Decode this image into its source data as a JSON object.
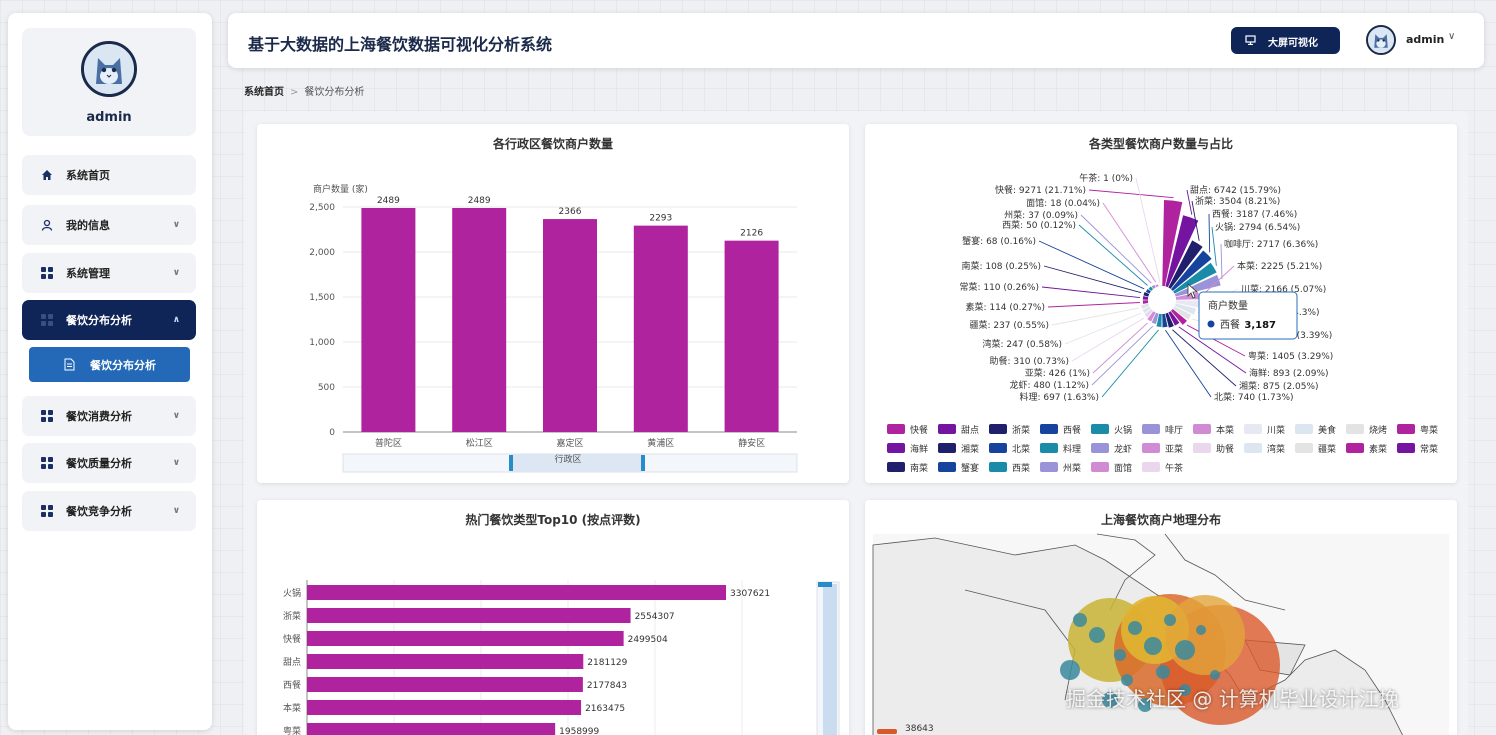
{
  "app": {
    "title": "基于大数据的上海餐饮数据可视化分析系统",
    "bigscreen_label": "大屏可视化",
    "username": "admin"
  },
  "sidebar": {
    "username": "admin",
    "items": [
      {
        "label": "系统首页",
        "icon": "home-icon"
      },
      {
        "label": "我的信息",
        "icon": "user-icon"
      },
      {
        "label": "系统管理",
        "icon": "grid-icon"
      },
      {
        "label": "餐饮分布分析",
        "icon": "grid-icon",
        "active": true
      },
      {
        "label": "餐饮消费分析",
        "icon": "grid-icon"
      },
      {
        "label": "餐饮质量分析",
        "icon": "grid-icon"
      },
      {
        "label": "餐饮竞争分析",
        "icon": "grid-icon"
      }
    ],
    "submenu_label": "餐饮分布分析"
  },
  "breadcrumb": {
    "home": "系统首页",
    "current": "餐饮分布分析"
  },
  "colors": {
    "navy": "#0f2557",
    "magenta": "#b0239f",
    "blue": "#2369b8"
  },
  "chart_data": [
    {
      "type": "bar",
      "title": "各行政区餐饮商户数量",
      "ylabel": "商户数量 (家)",
      "xlabel": "行政区",
      "categories": [
        "普陀区",
        "松江区",
        "嘉定区",
        "黄浦区",
        "静安区"
      ],
      "values": [
        2489,
        2489,
        2366,
        2293,
        2126
      ],
      "ylim": [
        0,
        2500
      ],
      "yticks": [
        "0",
        "500",
        "1,000",
        "1,500",
        "2,000",
        "2,500"
      ]
    },
    {
      "type": "pie",
      "title": "各类型餐饮商户数量与占比",
      "labels": [
        "快餐: 9271 (21.71%)",
        "甜点: 6742 (15.79%)",
        "浙菜: 3504 (8.21%)",
        "西餐: 3187 (7.46%)",
        "火锅: 2794 (6.54%)",
        "咖啡厅: 2717 (6.36%)",
        "本菜: 2225 (5.21%)",
        "川菜: 2166 (5.07%)",
        "美食: 1835 (4.3%)",
        "烧烤: 1446 (3.39%)",
        "粤菜: 1405 (3.29%)",
        "海鲜: 893 (2.09%)",
        "湘菜: 875 (2.05%)",
        "北菜: 740 (1.73%)",
        "料理: 697 (1.63%)",
        "龙虾: 480 (1.12%)",
        "亚菜: 426 (1%)",
        "助餐: 310 (0.73%)",
        "湾菜: 247 (0.58%)",
        "疆菜: 237 (0.55%)",
        "素菜: 114 (0.27%)",
        "常菜: 110 (0.26%)",
        "南菜: 108 (0.25%)",
        "蟹宴: 68 (0.16%)",
        "西菜: 50 (0.12%)",
        "州菜: 37 (0.09%)",
        "面馆: 18 (0.04%)",
        "午茶: 1 (0%)"
      ],
      "values": [
        9271,
        6742,
        3504,
        3187,
        2794,
        2717,
        2225,
        2166,
        1835,
        1446,
        1405,
        893,
        875,
        740,
        697,
        480,
        426,
        310,
        247,
        237,
        114,
        110,
        108,
        68,
        50,
        37,
        18,
        1
      ],
      "legend": [
        "快餐",
        "甜点",
        "浙菜",
        "西餐",
        "火锅",
        "咖啡厅",
        "本菜",
        "川菜",
        "美食",
        "烧烤",
        "粤菜",
        "海鲜",
        "湘菜",
        "北菜",
        "料理",
        "龙虾",
        "亚菜",
        "助餐",
        "湾菜",
        "疆菜",
        "素菜",
        "常菜",
        "南菜",
        "蟹宴",
        "西菜",
        "州菜",
        "面馆",
        "午茶"
      ],
      "legend_display": [
        "快餐",
        "甜点",
        "浙菜",
        "西餐",
        "火锅",
        "啡厅",
        "本菜",
        "川菜",
        "美食",
        "烧烤",
        "粤菜",
        "海鲜",
        "湘菜",
        "北菜",
        "料理",
        "龙虾",
        "亚菜",
        "助餐",
        "湾菜",
        "疆菜",
        "素菜",
        "常菜",
        "南菜",
        "蟹宴",
        "西菜",
        "州菜",
        "面馆",
        "午茶"
      ],
      "legend_position": "bottom",
      "tooltip": {
        "title": "商户数量",
        "name": "西餐",
        "value": "3,187"
      }
    },
    {
      "type": "bar",
      "orientation": "horizontal",
      "title": "热门餐饮类型Top10 (按点评数)",
      "categories": [
        "火锅",
        "浙菜",
        "快餐",
        "甜点",
        "西餐",
        "本菜",
        "粤菜"
      ],
      "values": [
        3307621,
        2554307,
        2499504,
        2181129,
        2177843,
        2163475,
        1958999
      ]
    },
    {
      "type": "map",
      "title": "上海餐饮商户地理分布",
      "legend_value": "38643"
    }
  ],
  "watermark": "掘金技术社区 @ 计算机毕业设计江挽"
}
